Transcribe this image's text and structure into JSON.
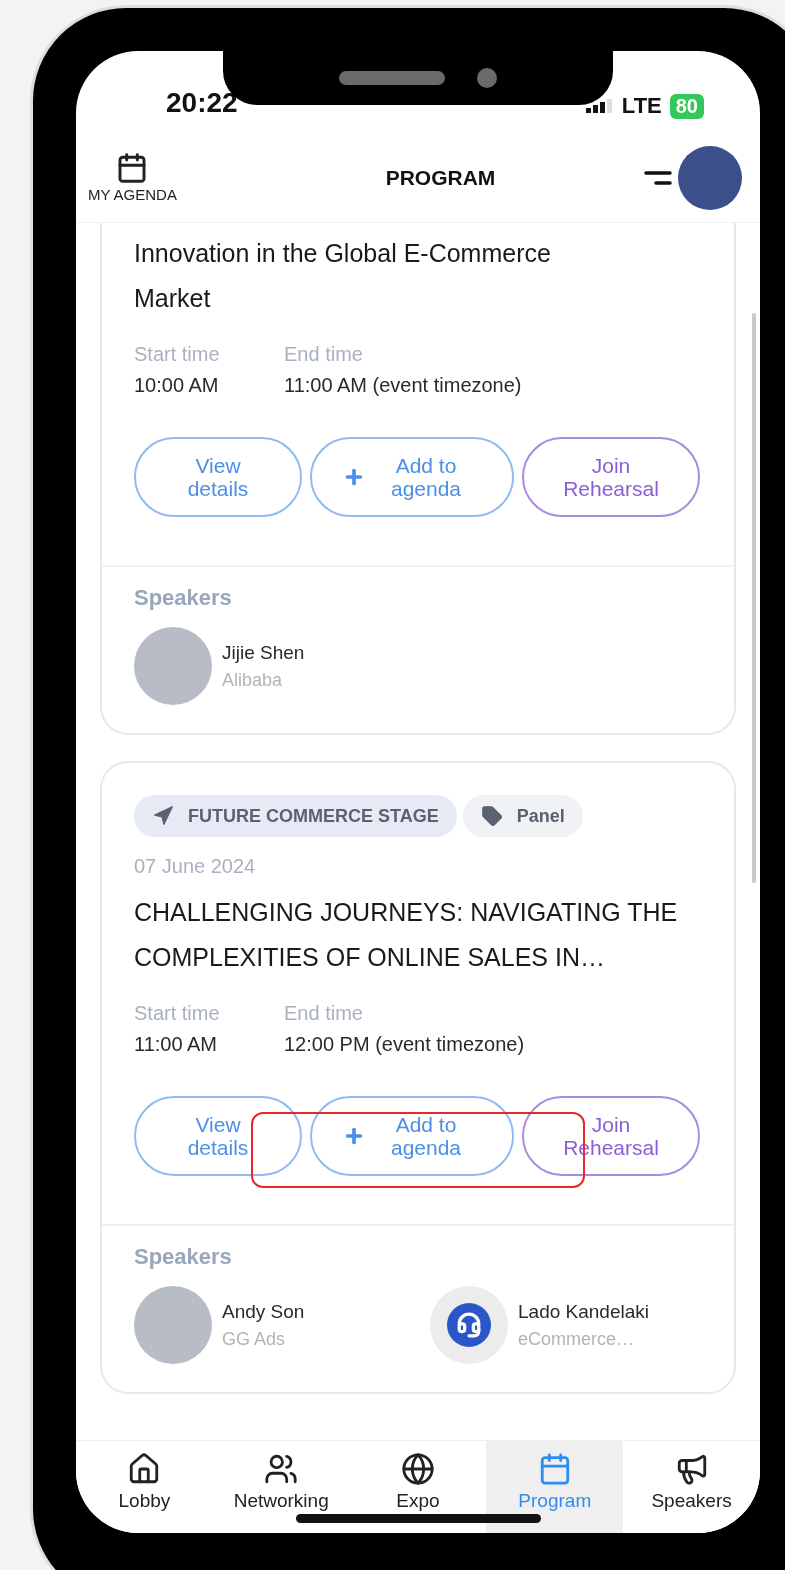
{
  "status_bar": {
    "time": "20:22",
    "network": "LTE",
    "battery": "80"
  },
  "header": {
    "agenda_label": "MY AGENDA",
    "title": "PROGRAM"
  },
  "sessions": [
    {
      "title": "Innovation in the Global E-Commerce Market",
      "start_label": "Start time",
      "start": "10:00 AM",
      "end_label": "End time",
      "end": "11:00 AM (event timezone)",
      "buttons": [
        {
          "label": "View details",
          "kind": "details"
        },
        {
          "label": "Add to agenda",
          "kind": "add"
        },
        {
          "label": "Join Rehearsal",
          "kind": "rehearsal"
        }
      ],
      "speakers_label": "Speakers",
      "speakers": [
        {
          "name": "Jijie Shen",
          "company": "Alibaba",
          "kind": "photo"
        }
      ],
      "highlighted": false
    },
    {
      "tags": [
        {
          "label": "FUTURE COMMERCE STAGE",
          "kind": "stage"
        },
        {
          "label": "Panel",
          "kind": "type"
        }
      ],
      "date": "07 June 2024",
      "title": "CHALLENGING JOURNEYS: NAVIGATING THE COMPLEXITIES OF ONLINE SALES IN…",
      "start_label": "Start time",
      "start": "11:00 AM",
      "end_label": "End time",
      "end": "12:00 PM (event timezone)",
      "buttons": [
        {
          "label": "View details",
          "kind": "details"
        },
        {
          "label": "Add to agenda",
          "kind": "add"
        },
        {
          "label": "Join Rehearsal",
          "kind": "rehearsal"
        }
      ],
      "speakers_label": "Speakers",
      "speakers": [
        {
          "name": "Andy Son",
          "company": "GG Ads",
          "kind": "photo"
        },
        {
          "name": "Lado Kandelaki",
          "company": "eCommerce…",
          "kind": "logo"
        }
      ],
      "highlighted": true
    }
  ],
  "tabs": [
    {
      "label": "Lobby",
      "selected": false
    },
    {
      "label": "Networking",
      "selected": false
    },
    {
      "label": "Expo",
      "selected": false
    },
    {
      "label": "Program",
      "selected": true
    },
    {
      "label": "Speakers",
      "selected": false
    }
  ]
}
